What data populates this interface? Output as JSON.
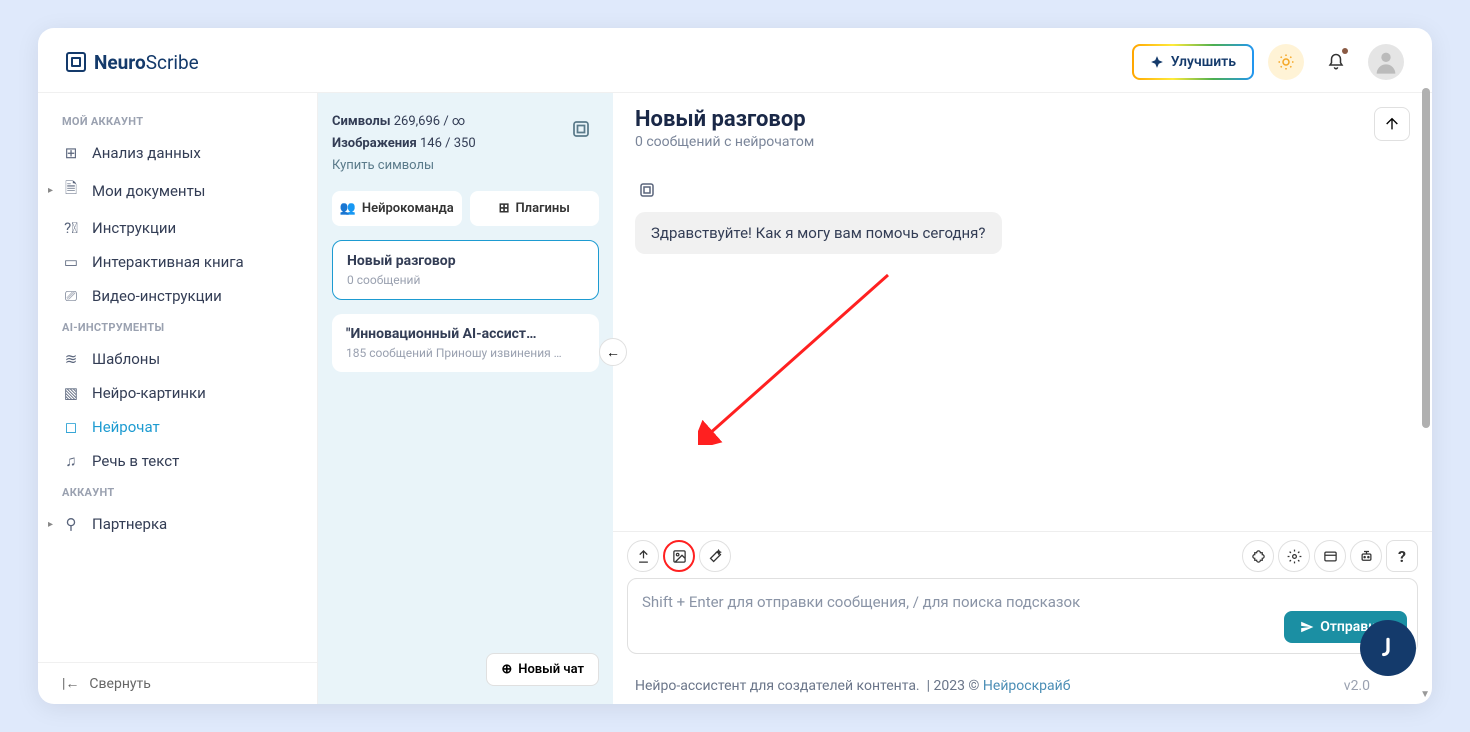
{
  "brand": {
    "name1": "Neuro",
    "name2": "Scribe"
  },
  "header": {
    "upgrade": "Улучшить"
  },
  "sidebar": {
    "sections": {
      "account_label": "МОЙ АККАУНТ",
      "ai_label": "AI-ИНСТРУМЕНТЫ",
      "acct_label": "АККАУНТ"
    },
    "items": {
      "analytics": "Анализ данных",
      "docs": "Мои документы",
      "instructions": "Инструкции",
      "book": "Интерактивная книга",
      "video": "Видео-инструкции",
      "templates": "Шаблоны",
      "images": "Нейро-картинки",
      "chat": "Нейрочат",
      "speech": "Речь в текст",
      "partner": "Партнерка"
    },
    "collapse": "Свернуть"
  },
  "midpanel": {
    "symbols_label": "Символы",
    "symbols_value": "269,696 / ∞",
    "images_label": "Изображения",
    "images_value": "146 / 350",
    "buy": "Купить символы",
    "team_btn": "Нейрокоманда",
    "plugins_btn": "Плагины",
    "convos": [
      {
        "title": "Новый разговор",
        "sub": "0 сообщений"
      },
      {
        "title": "\"Инновационный AI-ассист…",
        "sub": "185 сообщений Приношу извинения …"
      }
    ],
    "new_chat": "Новый чат"
  },
  "chat": {
    "title": "Новый разговор",
    "subtitle": "0 сообщений с нейрочатом",
    "greeting": "Здравствуйте! Как я могу вам помочь сегодня?",
    "placeholder": "Shift + Enter для отправки сообщения, / для поиска подсказок",
    "send": "Отправить"
  },
  "footer": {
    "text1": "Нейро-ассистент для создателей контента.",
    "text2": "| 2023 ©",
    "link": "Нейроскрайб",
    "version": "v2.0"
  }
}
